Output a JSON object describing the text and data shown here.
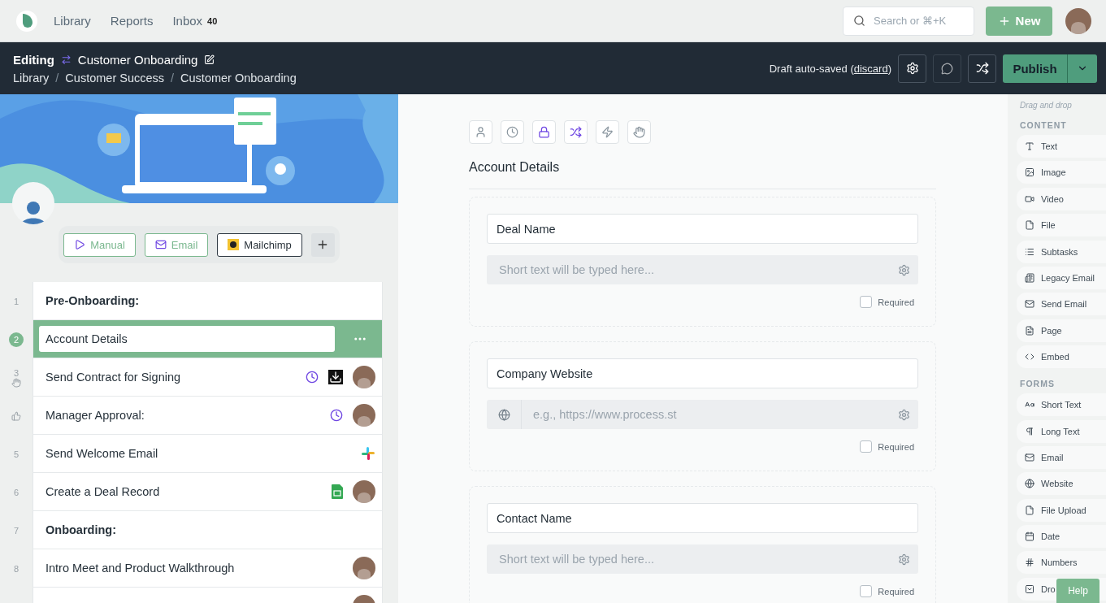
{
  "top_nav": {
    "links": [
      {
        "label": "Library"
      },
      {
        "label": "Reports"
      },
      {
        "label": "Inbox",
        "badge": "40"
      }
    ],
    "search": {
      "placeholder": "Search or ⌘+K"
    },
    "new_button": "New"
  },
  "header": {
    "mode": "Editing",
    "title": "Customer Onboarding",
    "breadcrumb": [
      {
        "label": "Library"
      },
      {
        "separator": "/",
        "label": "Customer Success"
      },
      {
        "separator": "/",
        "label": "Customer Onboarding"
      }
    ],
    "save_status": "Draft auto-saved (",
    "discard": "discard",
    "save_status_end": ")",
    "publish": "Publish"
  },
  "triggers": [
    {
      "label": "Manual",
      "kind": "trigger"
    },
    {
      "label": "Email",
      "kind": "trigger"
    },
    {
      "label": "Mailchimp",
      "kind": "integration"
    }
  ],
  "tasks": [
    {
      "number": "1",
      "label": "Pre-Onboarding:",
      "kind": "heading",
      "selected": false
    },
    {
      "number": "2",
      "label": "Account Details",
      "kind": "task",
      "selected": true
    },
    {
      "number": "3",
      "label": "Send Contract for Signing",
      "kind": "task",
      "selected": false
    },
    {
      "label": "Manager Approval:",
      "kind": "approval",
      "selected": false
    },
    {
      "number": "5",
      "label": "Send Welcome Email",
      "kind": "task",
      "selected": false
    },
    {
      "number": "6",
      "label": "Create a Deal Record",
      "kind": "task",
      "selected": false
    },
    {
      "number": "7",
      "label": "Onboarding:",
      "kind": "heading",
      "selected": false
    },
    {
      "number": "8",
      "label": "Intro Meet and Product Walkthrough",
      "kind": "task",
      "selected": false
    },
    {
      "kind": "task",
      "selected": false
    }
  ],
  "task_toolbar": [
    {
      "active": false
    },
    {
      "active": false
    },
    {
      "active": true
    },
    {
      "active": true
    },
    {
      "active": false
    },
    {
      "active": false
    }
  ],
  "task_title": "Account Details",
  "widgets": [
    {
      "label": "Deal Name",
      "kind": "short_text",
      "placeholder": "Short text will be typed here...",
      "required_label": "Required",
      "required": false
    },
    {
      "label": "Company Website",
      "kind": "website",
      "placeholder": "e.g., https://www.process.st",
      "required_label": "Required",
      "required": false
    },
    {
      "label": "Contact Name",
      "kind": "short_text",
      "placeholder": "Short text will be typed here...",
      "required_label": "Required",
      "required": false
    }
  ],
  "palette": {
    "hint": "Drag and drop",
    "sections": [
      {
        "title": "CONTENT",
        "items": [
          "Text",
          "Image",
          "Video",
          "File",
          "Subtasks",
          "Legacy Email",
          "Send Email",
          "Page",
          "Embed"
        ]
      },
      {
        "title": "FORMS",
        "items": [
          "Short Text",
          "Long Text",
          "Email",
          "Website",
          "File Upload",
          "Date",
          "Numbers",
          "Dro"
        ]
      }
    ]
  },
  "help_button": "Help"
}
